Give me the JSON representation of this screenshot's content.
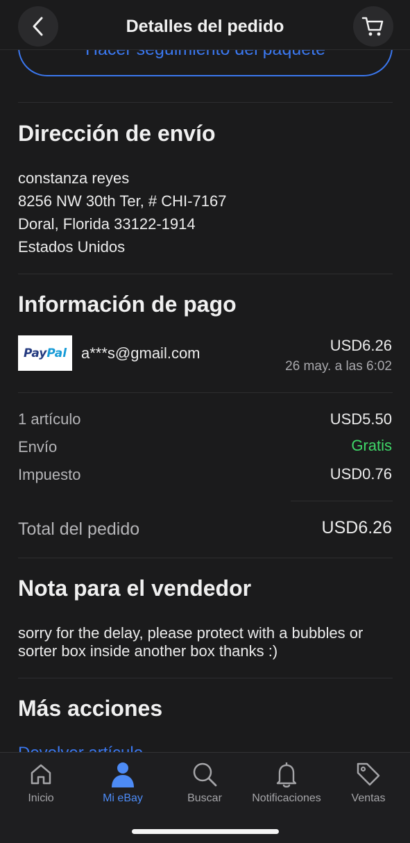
{
  "header": {
    "title": "Detalles del pedido"
  },
  "track_button": {
    "label": "Hacer seguimiento del paquete"
  },
  "shipping": {
    "title": "Dirección de envío",
    "lines": [
      "constanza reyes",
      "8256 NW 30th Ter, # CHI-7167",
      "Doral, Florida 33122-1914",
      "Estados Unidos"
    ]
  },
  "payment": {
    "title": "Información de pago",
    "method_logo_left": "Pay",
    "method_logo_right": "Pal",
    "email": "a***s@gmail.com",
    "amount": "USD6.26",
    "date": "26 may. a las 6:02"
  },
  "summary": {
    "items_label": "1 artículo",
    "items_value": "USD5.50",
    "shipping_label": "Envío",
    "shipping_value": "Gratis",
    "tax_label": "Impuesto",
    "tax_value": "USD0.76",
    "total_label": "Total del pedido",
    "total_value": "USD6.26"
  },
  "note": {
    "title": "Nota para el vendedor",
    "text": "sorry for the delay, please protect with a bubbles or sorter box inside another box thanks :)"
  },
  "more_actions": {
    "title": "Más acciones",
    "first_link": "Devolver artículo"
  },
  "tabs": [
    {
      "label": "Inicio",
      "icon": "home-icon"
    },
    {
      "label": "Mi eBay",
      "icon": "profile-icon"
    },
    {
      "label": "Buscar",
      "icon": "search-icon"
    },
    {
      "label": "Notificaciones",
      "icon": "bell-icon"
    },
    {
      "label": "Ventas",
      "icon": "tag-icon"
    }
  ],
  "colors": {
    "accent": "#3b78f0",
    "free_shipping": "#3fd868",
    "background": "#1b1b1c"
  }
}
